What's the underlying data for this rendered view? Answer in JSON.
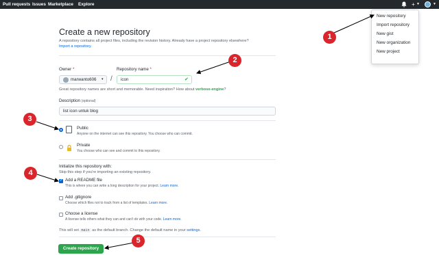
{
  "nav": {
    "items": [
      "Pull requests",
      "Issues",
      "Marketplace",
      "Explore"
    ],
    "bell_icon": "bell-icon",
    "plus_icon": "plus-icon"
  },
  "dropdown": {
    "items": [
      "New repository",
      "Import repository",
      "New gist",
      "New organization",
      "New project"
    ]
  },
  "page": {
    "title": "Create a new repository",
    "subtitle": "A repository contains all project files, including the revision history. Already have a project repository elsewhere?",
    "import_link": "Import a repository."
  },
  "owner": {
    "label": "Owner",
    "required": "*",
    "value": "marwanto606"
  },
  "repo_name": {
    "label": "Repository name",
    "required": "*",
    "value": "icon"
  },
  "hint": {
    "text": "Great repository names are short and memorable. Need inspiration? How about",
    "suggestion": "verbose-engine",
    "end": "?"
  },
  "description": {
    "label": "Description",
    "optional": "(optional)",
    "value": "list icon untuk blog"
  },
  "visibility": {
    "public_label": "Public",
    "public_desc": "Anyone on the internet can see this repository. You choose who can commit.",
    "private_label": "Private",
    "private_desc": "You choose who can see and commit to this repository."
  },
  "init": {
    "title": "Initialize this repository with:",
    "subtitle": "Skip this step if you're importing an existing repository.",
    "readme_label": "Add a README file",
    "readme_desc": "This is where you can write a long description for your project.",
    "gitignore_label": "Add .gitignore",
    "gitignore_desc": "Choose which files not to track from a list of templates.",
    "license_label": "Choose a license",
    "license_desc": "A license tells others what they can and can't do with your code.",
    "learn_more": "Learn more.",
    "readme_checked": true
  },
  "branch_note": {
    "prefix": "This will set",
    "branch": "main",
    "middle": "as the default branch. Change the default name in your",
    "link": "settings",
    "end": "."
  },
  "create_button": "Create repository",
  "callouts": [
    "1",
    "2",
    "3",
    "4",
    "5"
  ],
  "colors": {
    "nav_bg": "#24292e",
    "create_button": "#2ea44f",
    "callout": "#d9252b",
    "link": "#0366d6"
  }
}
